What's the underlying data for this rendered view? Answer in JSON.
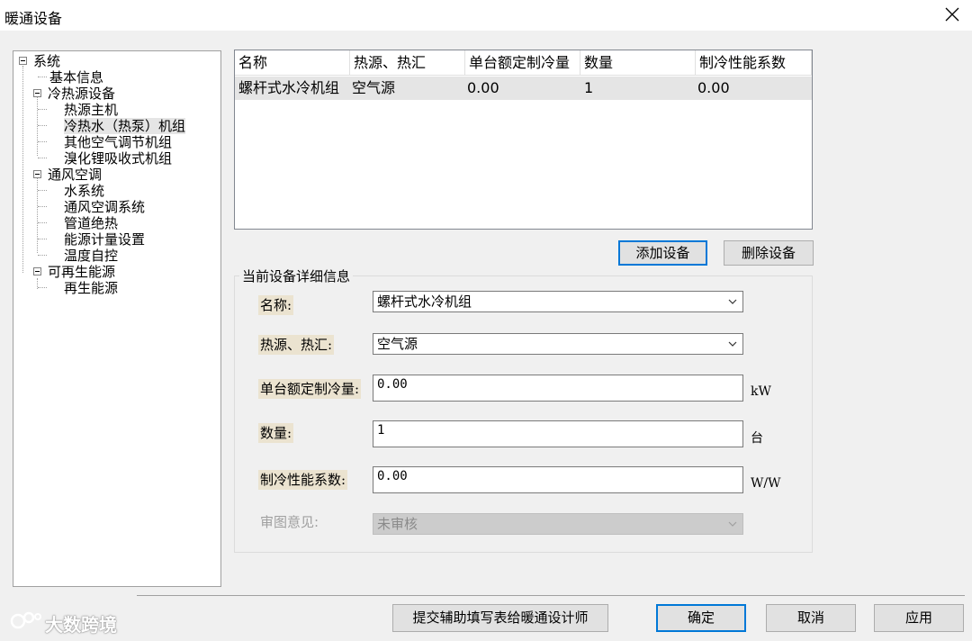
{
  "window": {
    "title": "暖通设备"
  },
  "tree": {
    "items": [
      {
        "label": "系统"
      },
      {
        "label": "基本信息"
      },
      {
        "label": "冷热源设备"
      },
      {
        "label": "热源主机"
      },
      {
        "label": "冷热水（热泵）机组"
      },
      {
        "label": "其他空气调节机组"
      },
      {
        "label": "溴化锂吸收式机组"
      },
      {
        "label": "通风空调"
      },
      {
        "label": "水系统"
      },
      {
        "label": "通风空调系统"
      },
      {
        "label": "管道绝热"
      },
      {
        "label": "能源计量设置"
      },
      {
        "label": "温度自控"
      },
      {
        "label": "可再生能源"
      },
      {
        "label": "再生能源"
      }
    ],
    "selected": "冷热水（热泵）机组"
  },
  "list": {
    "columns": [
      "名称",
      "热源、热汇",
      "单台额定制冷量",
      "数量",
      "制冷性能系数"
    ],
    "rows": [
      [
        "螺杆式水冷机组",
        "空气源",
        "0.00",
        "1",
        "0.00"
      ]
    ]
  },
  "buttons": {
    "add": "添加设备",
    "delete": "删除设备"
  },
  "details": {
    "group_title": "当前设备详细信息",
    "name_label": "名称:",
    "name_value": "螺杆式水冷机组",
    "source_label": "热源、热汇:",
    "source_value": "空气源",
    "capacity_label": "单台额定制冷量:",
    "capacity_value": "0.00",
    "capacity_unit": "kW",
    "qty_label": "数量:",
    "qty_value": "1",
    "qty_unit": "台",
    "cop_label": "制冷性能系数:",
    "cop_value": "0.00",
    "cop_unit": "W/W",
    "review_label": "审图意见:",
    "review_value": "未审核"
  },
  "footer": {
    "submit": "提交辅助填写表给暖通设计师",
    "ok": "确定",
    "cancel": "取消",
    "apply": "应用",
    "watermark": "大数跨境"
  }
}
